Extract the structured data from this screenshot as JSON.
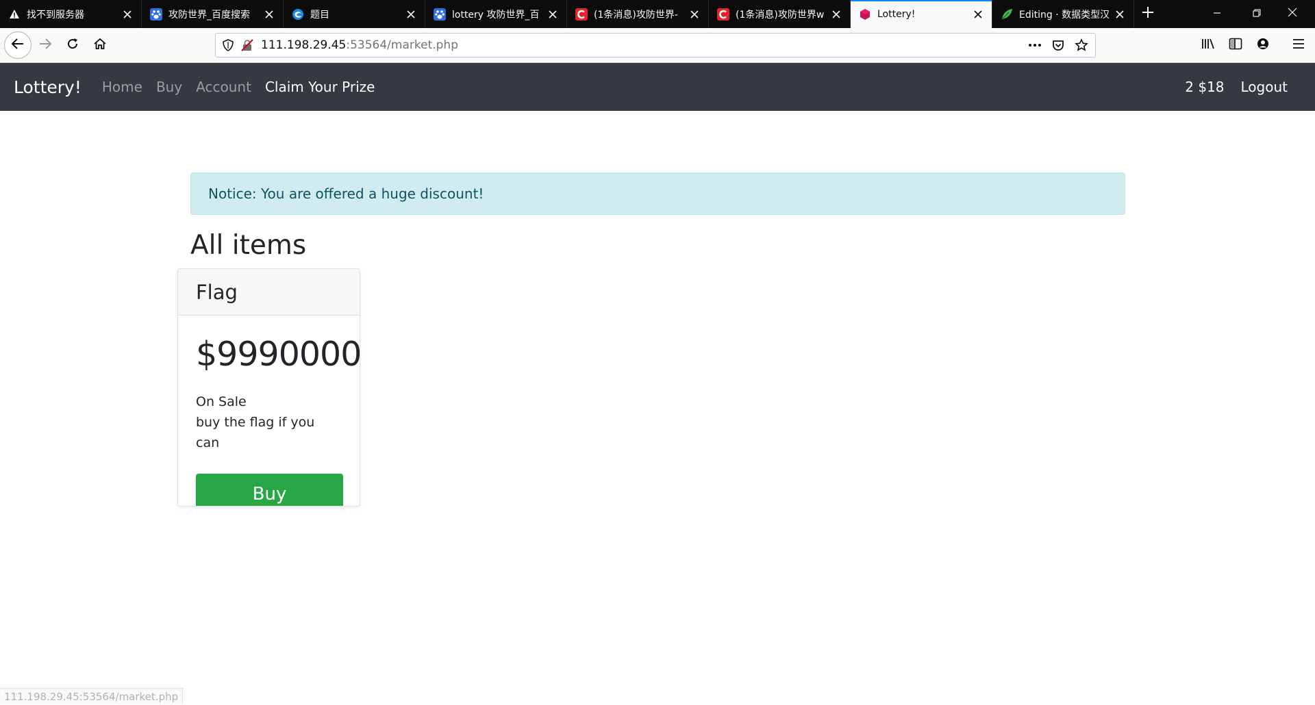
{
  "browser": {
    "tabs": [
      {
        "title": "找不到服务器",
        "icon": "warning-icon",
        "active": false
      },
      {
        "title": "攻防世界_百度搜索",
        "icon": "baidu-paw-icon",
        "active": false
      },
      {
        "title": "题目",
        "icon": "globe-swirl-icon",
        "active": false
      },
      {
        "title": "lottery 攻防世界_百",
        "icon": "baidu-paw-icon",
        "active": false
      },
      {
        "title": "(1条消息)攻防世界-",
        "icon": "csdn-c-icon",
        "active": false
      },
      {
        "title": "(1条消息)攻防世界w",
        "icon": "csdn-c-icon",
        "active": false
      },
      {
        "title": "Lottery!",
        "icon": "hexagon-icon",
        "active": true
      },
      {
        "title": "Editing · 数据类型汉",
        "icon": "leaf-icon",
        "active": false
      }
    ],
    "url": {
      "host": "111.198.29.45",
      "rest": ":53564/market.php"
    },
    "status_url": "111.198.29.45:53564/market.php",
    "colors": {
      "tabbar_bg": "#0c0c0d",
      "active_tab_accent": "#0a84ff"
    }
  },
  "navbar": {
    "brand": "Lottery!",
    "links": [
      "Home",
      "Buy",
      "Account",
      "Claim Your Prize"
    ],
    "account_summary": "2 $18",
    "logout": "Logout"
  },
  "notice": "Notice: You are offered a huge discount!",
  "section_title": "All items",
  "item": {
    "name": "Flag",
    "price": "$9990000",
    "status": "On Sale",
    "description": "buy the flag if you can",
    "buy_label": "Buy"
  },
  "colors": {
    "navbar_bg": "#343a40",
    "alert_bg": "#d1ecf1",
    "alert_text": "#0c5460",
    "buy_button": "#28a745"
  }
}
